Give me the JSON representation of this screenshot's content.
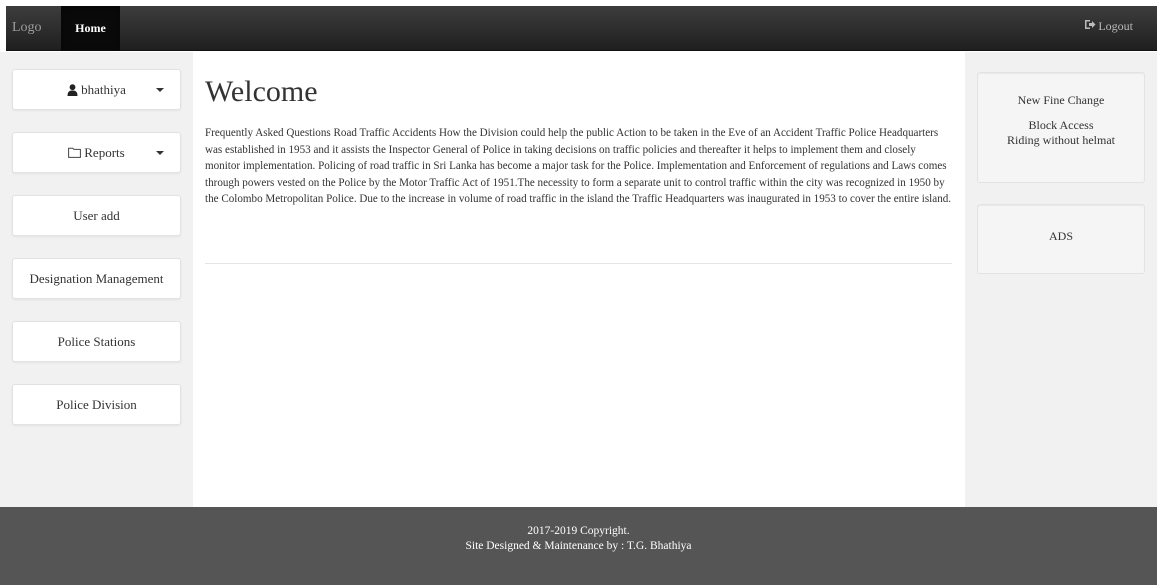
{
  "navbar": {
    "brand": "Logo",
    "home_label": "Home",
    "logout_label": "Logout",
    "logout_icon": "sign-out-icon"
  },
  "sidebar": {
    "user_label": "bhathiya",
    "user_icon": "user-icon",
    "reports_label": "Reports",
    "reports_icon": "folder-icon",
    "items": [
      {
        "label": "User add"
      },
      {
        "label": "Designation Management"
      },
      {
        "label": "Police Stations"
      },
      {
        "label": "Police Division"
      }
    ]
  },
  "main": {
    "heading": "Welcome",
    "body": "Frequently Asked Questions Road Traffic Accidents How the Division could help the public Action to be taken in the Eve of an Accident Traffic Police Headquarters was established in 1953 and it assists the Inspector General of Police in taking decisions on traffic policies and thereafter it helps to implement them and closely monitor implementation. Policing of road traffic in Sri Lanka has become a major task for the Police. Implementation and Enforcement of regulations and Laws comes through powers vested on the Police by the Motor Traffic Act of 1951.The necessity to form a separate unit to control traffic within the city was recognized in 1950 by the Colombo Metropolitan Police. Due to the increase in volume of road traffic in the island the Traffic Headquarters was inaugurated in 1953 to cover the entire island."
  },
  "right_sidebar": {
    "notices": [
      "New Fine Change",
      "Block Access",
      "Riding without helmat"
    ],
    "ads_label": "ADS"
  },
  "footer": {
    "copyright": "2017-2019 Copyright.",
    "credit": "Site Designed & Maintenance by : T.G. Bhathiya"
  }
}
